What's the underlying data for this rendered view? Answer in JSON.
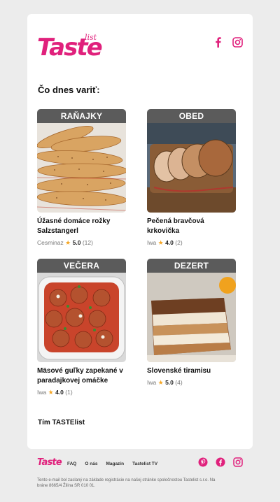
{
  "header": {
    "logo_text": "Taste",
    "logo_sub": "list",
    "social": [
      "facebook-icon",
      "instagram-icon"
    ]
  },
  "heading": "Čo dnes variť:",
  "recipes": [
    {
      "tag": "RAŇAJKY",
      "title": "Úžasné domáce rožky Salzstangerl",
      "author": "Cesminaz",
      "rating": "5.0",
      "count": "(12)"
    },
    {
      "tag": "OBED",
      "title": "Pečená bravčová krkovička",
      "author": "Iwa",
      "rating": "4.0",
      "count": "(2)"
    },
    {
      "tag": "VEČERA",
      "title": "Mäsové guľky zapekané v paradajkovej omáčke",
      "author": "Iwa",
      "rating": "4.0",
      "count": "(1)"
    },
    {
      "tag": "DEZERT",
      "title": "Slovenské tiramisu",
      "author": "Iwa",
      "rating": "5.0",
      "count": "(4)"
    }
  ],
  "signoff": "Tím TASTElist",
  "footer": {
    "logo_text": "Taste",
    "nav": [
      "FAQ",
      "O nás",
      "Magazín",
      "Tastelist TV"
    ],
    "social": [
      "pinterest-icon",
      "facebook-icon",
      "instagram-icon"
    ],
    "note": "Tento e-mail bol zaslaný na základe registrácie na našej stránke spoločnostou Tastelist s.r.o. Na bráne 8665/4 Žilina SR 010 01."
  },
  "colors": {
    "brand": "#e0217c",
    "tag_bg": "#5b5b5b",
    "star": "#f5a623",
    "page_bg": "#ececec"
  }
}
